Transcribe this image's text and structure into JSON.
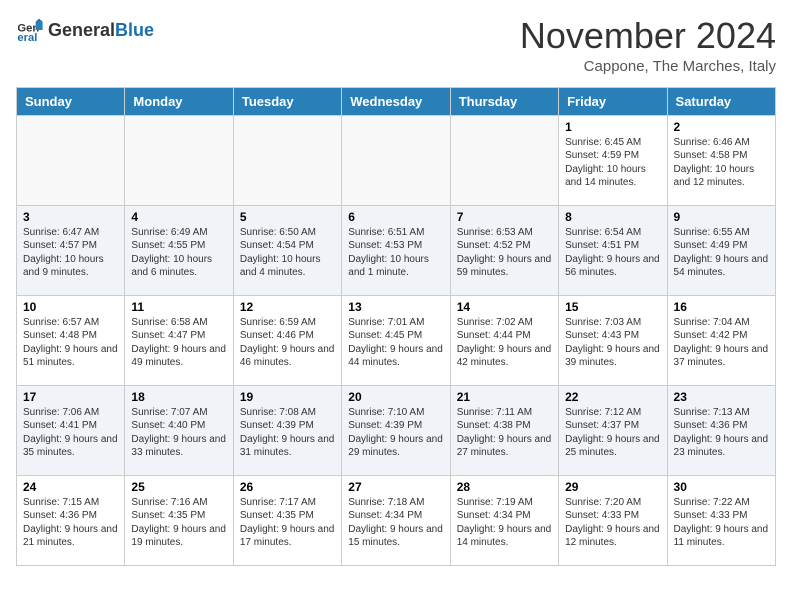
{
  "header": {
    "logo_general": "General",
    "logo_blue": "Blue",
    "month": "November 2024",
    "location": "Cappone, The Marches, Italy"
  },
  "days_of_week": [
    "Sunday",
    "Monday",
    "Tuesday",
    "Wednesday",
    "Thursday",
    "Friday",
    "Saturday"
  ],
  "weeks": [
    [
      {
        "day": "",
        "info": ""
      },
      {
        "day": "",
        "info": ""
      },
      {
        "day": "",
        "info": ""
      },
      {
        "day": "",
        "info": ""
      },
      {
        "day": "",
        "info": ""
      },
      {
        "day": "1",
        "info": "Sunrise: 6:45 AM\nSunset: 4:59 PM\nDaylight: 10 hours and 14 minutes."
      },
      {
        "day": "2",
        "info": "Sunrise: 6:46 AM\nSunset: 4:58 PM\nDaylight: 10 hours and 12 minutes."
      }
    ],
    [
      {
        "day": "3",
        "info": "Sunrise: 6:47 AM\nSunset: 4:57 PM\nDaylight: 10 hours and 9 minutes."
      },
      {
        "day": "4",
        "info": "Sunrise: 6:49 AM\nSunset: 4:55 PM\nDaylight: 10 hours and 6 minutes."
      },
      {
        "day": "5",
        "info": "Sunrise: 6:50 AM\nSunset: 4:54 PM\nDaylight: 10 hours and 4 minutes."
      },
      {
        "day": "6",
        "info": "Sunrise: 6:51 AM\nSunset: 4:53 PM\nDaylight: 10 hours and 1 minute."
      },
      {
        "day": "7",
        "info": "Sunrise: 6:53 AM\nSunset: 4:52 PM\nDaylight: 9 hours and 59 minutes."
      },
      {
        "day": "8",
        "info": "Sunrise: 6:54 AM\nSunset: 4:51 PM\nDaylight: 9 hours and 56 minutes."
      },
      {
        "day": "9",
        "info": "Sunrise: 6:55 AM\nSunset: 4:49 PM\nDaylight: 9 hours and 54 minutes."
      }
    ],
    [
      {
        "day": "10",
        "info": "Sunrise: 6:57 AM\nSunset: 4:48 PM\nDaylight: 9 hours and 51 minutes."
      },
      {
        "day": "11",
        "info": "Sunrise: 6:58 AM\nSunset: 4:47 PM\nDaylight: 9 hours and 49 minutes."
      },
      {
        "day": "12",
        "info": "Sunrise: 6:59 AM\nSunset: 4:46 PM\nDaylight: 9 hours and 46 minutes."
      },
      {
        "day": "13",
        "info": "Sunrise: 7:01 AM\nSunset: 4:45 PM\nDaylight: 9 hours and 44 minutes."
      },
      {
        "day": "14",
        "info": "Sunrise: 7:02 AM\nSunset: 4:44 PM\nDaylight: 9 hours and 42 minutes."
      },
      {
        "day": "15",
        "info": "Sunrise: 7:03 AM\nSunset: 4:43 PM\nDaylight: 9 hours and 39 minutes."
      },
      {
        "day": "16",
        "info": "Sunrise: 7:04 AM\nSunset: 4:42 PM\nDaylight: 9 hours and 37 minutes."
      }
    ],
    [
      {
        "day": "17",
        "info": "Sunrise: 7:06 AM\nSunset: 4:41 PM\nDaylight: 9 hours and 35 minutes."
      },
      {
        "day": "18",
        "info": "Sunrise: 7:07 AM\nSunset: 4:40 PM\nDaylight: 9 hours and 33 minutes."
      },
      {
        "day": "19",
        "info": "Sunrise: 7:08 AM\nSunset: 4:39 PM\nDaylight: 9 hours and 31 minutes."
      },
      {
        "day": "20",
        "info": "Sunrise: 7:10 AM\nSunset: 4:39 PM\nDaylight: 9 hours and 29 minutes."
      },
      {
        "day": "21",
        "info": "Sunrise: 7:11 AM\nSunset: 4:38 PM\nDaylight: 9 hours and 27 minutes."
      },
      {
        "day": "22",
        "info": "Sunrise: 7:12 AM\nSunset: 4:37 PM\nDaylight: 9 hours and 25 minutes."
      },
      {
        "day": "23",
        "info": "Sunrise: 7:13 AM\nSunset: 4:36 PM\nDaylight: 9 hours and 23 minutes."
      }
    ],
    [
      {
        "day": "24",
        "info": "Sunrise: 7:15 AM\nSunset: 4:36 PM\nDaylight: 9 hours and 21 minutes."
      },
      {
        "day": "25",
        "info": "Sunrise: 7:16 AM\nSunset: 4:35 PM\nDaylight: 9 hours and 19 minutes."
      },
      {
        "day": "26",
        "info": "Sunrise: 7:17 AM\nSunset: 4:35 PM\nDaylight: 9 hours and 17 minutes."
      },
      {
        "day": "27",
        "info": "Sunrise: 7:18 AM\nSunset: 4:34 PM\nDaylight: 9 hours and 15 minutes."
      },
      {
        "day": "28",
        "info": "Sunrise: 7:19 AM\nSunset: 4:34 PM\nDaylight: 9 hours and 14 minutes."
      },
      {
        "day": "29",
        "info": "Sunrise: 7:20 AM\nSunset: 4:33 PM\nDaylight: 9 hours and 12 minutes."
      },
      {
        "day": "30",
        "info": "Sunrise: 7:22 AM\nSunset: 4:33 PM\nDaylight: 9 hours and 11 minutes."
      }
    ]
  ]
}
